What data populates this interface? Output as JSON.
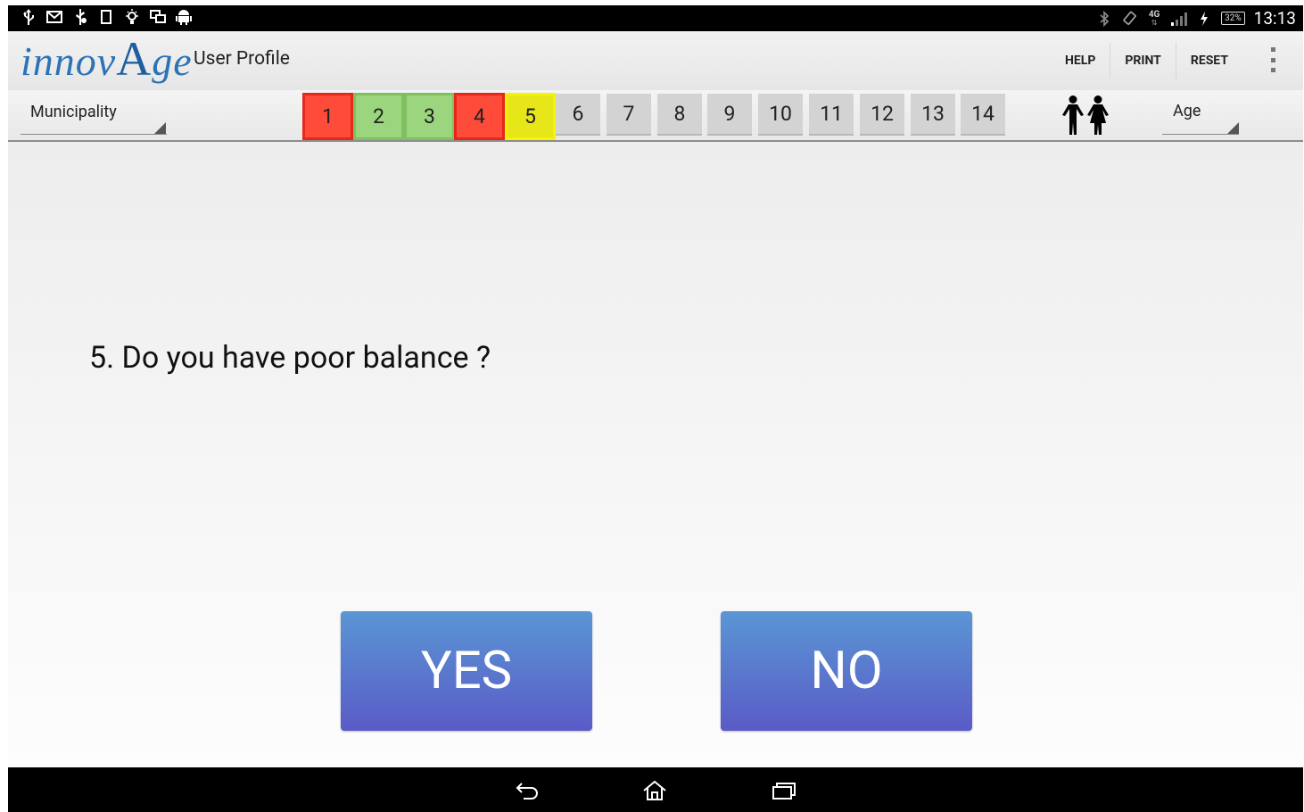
{
  "status_bar": {
    "left_icons": [
      "usb-icon",
      "gmail-icon",
      "usb-debug-icon",
      "screenshot-icon",
      "lightbulb-icon",
      "sync-icon",
      "android-icon"
    ],
    "right_icons": [
      "bluetooth-icon",
      "rotation-lock-icon",
      "network-4g-icon",
      "signal-icon",
      "charging-icon"
    ],
    "network_type": "4G",
    "battery_percent": "32%",
    "time": "13:13"
  },
  "action_bar": {
    "logo_text_1": "innov",
    "logo_text_2": "A",
    "logo_text_3": "ge",
    "title": "User Profile",
    "help_label": "HELP",
    "print_label": "PRINT",
    "reset_label": "RESET"
  },
  "nav_bar": {
    "municipality_label": "Municipality",
    "age_label": "Age",
    "questions": [
      {
        "number": "1",
        "status": "red"
      },
      {
        "number": "2",
        "status": "green"
      },
      {
        "number": "3",
        "status": "green"
      },
      {
        "number": "4",
        "status": "red"
      },
      {
        "number": "5",
        "status": "yellow"
      },
      {
        "number": "6",
        "status": "none"
      },
      {
        "number": "7",
        "status": "none"
      },
      {
        "number": "8",
        "status": "none"
      },
      {
        "number": "9",
        "status": "none"
      },
      {
        "number": "10",
        "status": "none"
      },
      {
        "number": "11",
        "status": "none"
      },
      {
        "number": "12",
        "status": "none"
      },
      {
        "number": "13",
        "status": "none"
      },
      {
        "number": "14",
        "status": "none"
      }
    ],
    "current_question": "5"
  },
  "status_colors": {
    "red": {
      "fill": "#ff4b3a",
      "border": "#e8261a"
    },
    "green": {
      "fill": "#9bd67e",
      "border": "#7fc060"
    },
    "yellow": {
      "fill": "#e6e619",
      "border": "#f4f40a"
    },
    "none": {
      "fill": "#d3d3d3",
      "border": "#d3d3d3"
    }
  },
  "question": {
    "text": "5. Do you have poor balance ?"
  },
  "answers": {
    "yes_label": "YES",
    "no_label": "NO"
  },
  "system_nav": [
    "back-icon",
    "home-icon",
    "recent-apps-icon"
  ]
}
